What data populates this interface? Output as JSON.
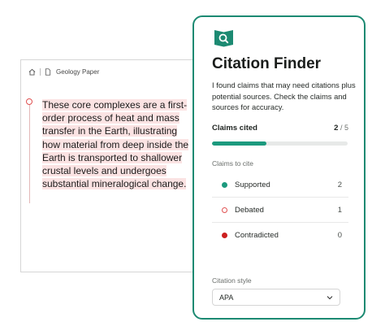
{
  "document": {
    "breadcrumb_title": "Geology Paper",
    "highlighted_text": "These core complexes are a first-order process of heat and mass transfer in the Earth, illustrating how material from deep inside the Earth is transported to shallower crustal levels and undergoes substantial mineralogical change.",
    "icons": [
      "home-icon",
      "document-icon"
    ]
  },
  "panel": {
    "icon": "book-search-icon",
    "title": "Citation Finder",
    "description": "I found claims that may need citations plus potential sources. Check the claims and sources for accuracy.",
    "claims_cited_label": "Claims cited",
    "claims_cited_count": "2",
    "claims_cited_total": "/ 5",
    "claims_cited_progress": 0.4,
    "claims_to_cite_label": "Claims to cite",
    "claims": [
      {
        "label": "Supported",
        "count": "2"
      },
      {
        "label": "Debated",
        "count": "1"
      },
      {
        "label": "Contradicted",
        "count": "0"
      }
    ],
    "citation_style_label": "Citation style",
    "citation_style_value": "APA"
  },
  "colors": {
    "accent": "#1c8a72",
    "progress": "#1c9a7e",
    "supported": "#1c9a7e",
    "debated": "#e05252",
    "contradicted": "#cc1f1f",
    "highlight": "#fbe3e3"
  }
}
